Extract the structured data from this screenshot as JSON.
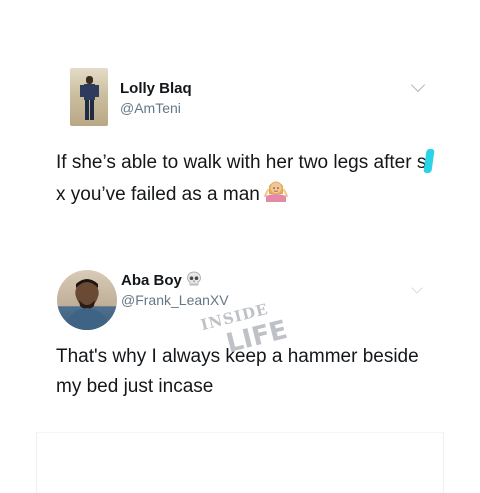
{
  "tweets": [
    {
      "name": "Lolly Blaq",
      "handle": "@AmTeni",
      "text_before": "If she’s able to walk with her two legs after s",
      "text_after": "x you’ve failed as a man",
      "emoji": "woman-shrugging-emoji"
    },
    {
      "name": "Aba Boy",
      "name_emoji": "skull-emoji",
      "handle": "@Frank_LeanXV",
      "text": "That's why I always keep a hammer beside my bed just incase"
    }
  ],
  "watermark": {
    "line1": "INSIDE",
    "line2": "LIFE"
  },
  "colors": {
    "censor": "#2ad4e6",
    "handle": "#657786",
    "text": "#14171a"
  }
}
